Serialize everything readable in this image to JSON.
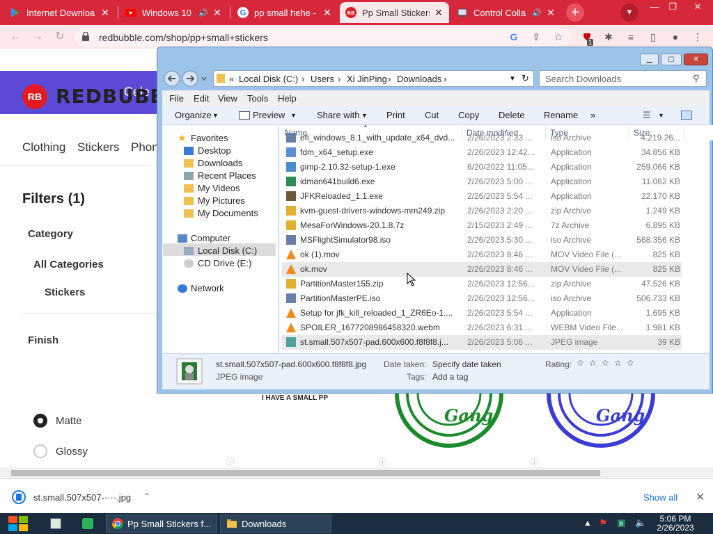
{
  "browser": {
    "tabs": [
      {
        "title": "Internet Downloa",
        "icon": "play-store-icon"
      },
      {
        "title": "Windows 10",
        "icon": "youtube-icon"
      },
      {
        "title": "pp small hehe - G",
        "icon": "google-icon"
      },
      {
        "title": "Pp Small Stickers",
        "icon": "redbubble-icon"
      },
      {
        "title": "Control Colla",
        "icon": "control-panel-icon"
      }
    ],
    "new_tab": "+",
    "url": "redbubble.com/shop/pp+small+stickers",
    "extension_badge": "1"
  },
  "page": {
    "banner_text": "Cele",
    "logo_mark": "RB",
    "brand": "REDBUBBLE",
    "nav": [
      "Clothing",
      "Stickers",
      "Phon"
    ],
    "filters_title": "Filters (1)",
    "category_label": "Category",
    "category_items": [
      "All Categories",
      "Stickers"
    ],
    "finish_label": "Finish",
    "finish_options": [
      {
        "label": "Matte",
        "selected": true
      },
      {
        "label": "Glossy",
        "selected": false
      }
    ],
    "sticker_caption": "I HAVE A SMALL PP",
    "gang_text": "Gang"
  },
  "download_bar": {
    "file": "st.small.507x507-····.jpg",
    "show_all": "Show all"
  },
  "explorer": {
    "breadcrumb": [
      "Local Disk (C:)",
      "Users",
      "Xi JinPing",
      "Downloads"
    ],
    "search_placeholder": "Search Downloads",
    "menu": [
      "File",
      "Edit",
      "View",
      "Tools",
      "Help"
    ],
    "commands": [
      "Organize",
      "Preview",
      "Share with",
      "Print",
      "Cut",
      "Copy",
      "Delete",
      "Rename",
      "»"
    ],
    "nav": {
      "favorites": "Favorites",
      "favorites_items": [
        "Desktop",
        "Downloads",
        "Recent Places",
        "My Videos",
        "My Pictures",
        "My Documents"
      ],
      "computer": "Computer",
      "computer_items": [
        "Local Disk (C:)",
        "CD Drive (E:)"
      ],
      "network": "Network"
    },
    "columns": {
      "name": "Name",
      "date": "Date modified",
      "type": "Type",
      "size": "Size"
    },
    "files": [
      {
        "name": "efi_windows_8.1_with_update_x64_dvd...",
        "date": "2/26/2023 2:33 ...",
        "type": "iso Archive",
        "size": "4.219.26...",
        "icon": "iso-icon"
      },
      {
        "name": "fdm_x64_setup.exe",
        "date": "2/26/2023 12:42...",
        "type": "Application",
        "size": "34.856 KB",
        "icon": "app-icon"
      },
      {
        "name": "gimp-2.10.32-setup-1.exe",
        "date": "6/20/2022 11:05...",
        "type": "Application",
        "size": "259.066 KB",
        "icon": "installer-icon"
      },
      {
        "name": "idman641build6.exe",
        "date": "2/26/2023 5:00 ...",
        "type": "Application",
        "size": "11.062 KB",
        "icon": "idm-icon"
      },
      {
        "name": "JFKReloaded_1.1.exe",
        "date": "2/26/2023 5:54 ...",
        "type": "Application",
        "size": "22.170 KB",
        "icon": "game-icon"
      },
      {
        "name": "kvm-guest-drivers-windows-mm249.zip",
        "date": "2/26/2023 2:20 ...",
        "type": "zip Archive",
        "size": "1.249 KB",
        "icon": "zip-icon"
      },
      {
        "name": "MesaForWindows-20.1.8.7z",
        "date": "2/15/2023 2:49 ...",
        "type": "7z Archive",
        "size": "6.895 KB",
        "icon": "zip-icon"
      },
      {
        "name": "MSFlightSimulator98.iso",
        "date": "2/26/2023 5:30 ...",
        "type": "iso Archive",
        "size": "568.356 KB",
        "icon": "iso-icon"
      },
      {
        "name": "ok (1).mov",
        "date": "2/26/2023 8:46 ...",
        "type": "MOV Video File (...",
        "size": "825 KB",
        "icon": "vlc-icon"
      },
      {
        "name": "ok.mov",
        "date": "2/26/2023 8:46 ...",
        "type": "MOV Video File (...",
        "size": "825 KB",
        "icon": "vlc-icon"
      },
      {
        "name": "PartitionMaster155.zip",
        "date": "2/26/2023 12:56...",
        "type": "zip Archive",
        "size": "47.526 KB",
        "icon": "zip-icon"
      },
      {
        "name": "PartitionMasterPE.iso",
        "date": "2/26/2023 12:56...",
        "type": "iso Archive",
        "size": "506.733 KB",
        "icon": "iso-icon"
      },
      {
        "name": "Setup for jfk_kill_reloaded_1_ZR6Eo-1....",
        "date": "2/26/2023 5:54 ...",
        "type": "Application",
        "size": "1.695 KB",
        "icon": "vlc-icon"
      },
      {
        "name": "SPOILER_1677208986458320.webm",
        "date": "2/26/2023 6:31 ...",
        "type": "WEBM Video File...",
        "size": "1.981 KB",
        "icon": "vlc-icon"
      },
      {
        "name": "st.small.507x507-pad.600x600.f8f8f8.j...",
        "date": "2/26/2023 5:06 ...",
        "type": "JPEG image",
        "size": "39 KB",
        "icon": "image-icon"
      }
    ],
    "hover_row": 9,
    "selected_row": 14,
    "details": {
      "filename": "st.small.507x507-pad.600x600.f8f8f8.jpg",
      "filetype": "JPEG image",
      "date_taken_label": "Date taken:",
      "date_taken_value": "Specify date taken",
      "tags_label": "Tags:",
      "tags_value": "Add a tag",
      "rating_label": "Rating:"
    }
  },
  "taskbar": {
    "items": [
      "Pp Small Stickers f...",
      "Downloads"
    ],
    "time": "5:06 PM",
    "date": "2/26/2023"
  },
  "colors": {
    "chrome_red": "#d7283b",
    "rb_banner": "#5b4bd6",
    "rb_red": "#e31b23",
    "gang_green": "#1a8a2a",
    "gang_blue": "#3b3bd6"
  }
}
